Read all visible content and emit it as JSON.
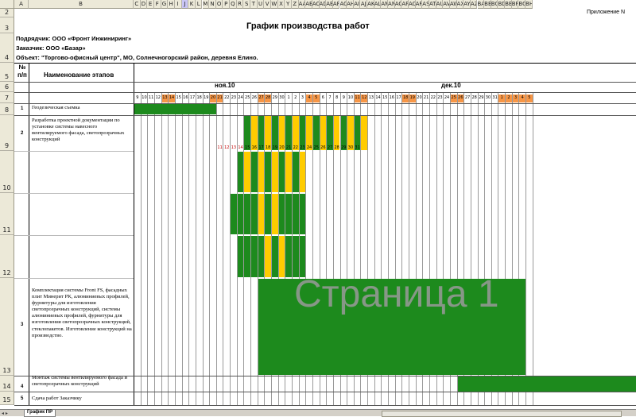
{
  "sheet": {
    "appendix_label": "Приложение N",
    "title": "График производства работ",
    "contractor": "Подрядчик:  ООО «Фронт Инжиниринг»",
    "customer": "Заказчик:  ООО «Базар»",
    "object": "Объект: \"Торгово-офисный центр\", МО, Солнечногорский район, деревня Елино.",
    "col_num_header": "№\nп/п",
    "col_stage_header": "Наименование этапов",
    "month1": "ноя.10",
    "month2": "дек.10",
    "watermark": "Страница 1",
    "tab_label": "График ПР"
  },
  "column_headers": [
    "A",
    "B",
    "C",
    "D",
    "E",
    "F",
    "G",
    "H",
    "I",
    "J",
    "K",
    "L",
    "M",
    "N",
    "O",
    "P",
    "Q",
    "R",
    "S",
    "T",
    "U",
    "V",
    "W",
    "X",
    "Y",
    "Z",
    "AA",
    "AB",
    "AC",
    "AD",
    "AE",
    "AF",
    "AG",
    "AH",
    "AI",
    "AJ",
    "AK",
    "AL",
    "AM",
    "AN",
    "AO",
    "AP",
    "AQ",
    "AR",
    "AS",
    "AT",
    "AU",
    "AV",
    "AW",
    "AX",
    "AY",
    "AZ",
    "BA",
    "BB",
    "BC",
    "BD",
    "BE",
    "BF",
    "BG",
    "BH"
  ],
  "row_headers": [
    "2",
    "3",
    "4",
    "5",
    "6",
    "7",
    "8",
    "9",
    "10",
    "11",
    "12",
    "13",
    "14",
    "15"
  ],
  "days": [
    "9",
    "10",
    "11",
    "12",
    "13",
    "14",
    "15",
    "16",
    "17",
    "18",
    "19",
    "20",
    "21",
    "22",
    "23",
    "24",
    "25",
    "26",
    "27",
    "28",
    "29",
    "30",
    "1",
    "2",
    "3",
    "4",
    "5",
    "6",
    "7",
    "8",
    "9",
    "10",
    "11",
    "12",
    "13",
    "14",
    "15",
    "16",
    "17",
    "18",
    "19",
    "20",
    "21",
    "22",
    "23",
    "24",
    "25",
    "26",
    "27",
    "28",
    "29",
    "30",
    "31",
    "1",
    "2",
    "3",
    "4",
    "5"
  ],
  "weekend_days": [
    4,
    5,
    11,
    12,
    18,
    19,
    25,
    26,
    32,
    33,
    39,
    40,
    46,
    47,
    53,
    54,
    55,
    56,
    57
  ],
  "tasks": [
    {
      "num": "1",
      "name": "Геодезическая съемка"
    },
    {
      "num": "2",
      "name": "Разработка проектной документации по установке системы навесного вентилируемого фасада, светопрозрачных конструкций"
    },
    {
      "num": "3",
      "name": "Комплектация системы Front FS, фасадных плит Минерит PK, алюминиевых профилей, фурнитуры для изготовления светопрозрачных конструкций, системы алюминиевых профилей, фурнитуры для изготовления светопрозрачных конструкций, стеклопакетов. Изготовление конструкций на производство."
    },
    {
      "num": "4",
      "name": "Монтаж системы вентилируемого фасада и светопрозрачных конструкций"
    },
    {
      "num": "5",
      "name": "Сдача работ Заказчику"
    }
  ],
  "task2_day_labels": [
    "11",
    "12",
    "13",
    "14",
    "15",
    "16",
    "17",
    "18",
    "19",
    "20",
    "21",
    "22",
    "23",
    "24",
    "25",
    "26",
    "27",
    "28",
    "29",
    "30",
    "31"
  ],
  "colors": {
    "green": "#1d8a1d",
    "yellow": "#ffcc00",
    "orange": "#f79646",
    "grid": "#c0c0c0",
    "header_bg": "#ece9d8"
  }
}
